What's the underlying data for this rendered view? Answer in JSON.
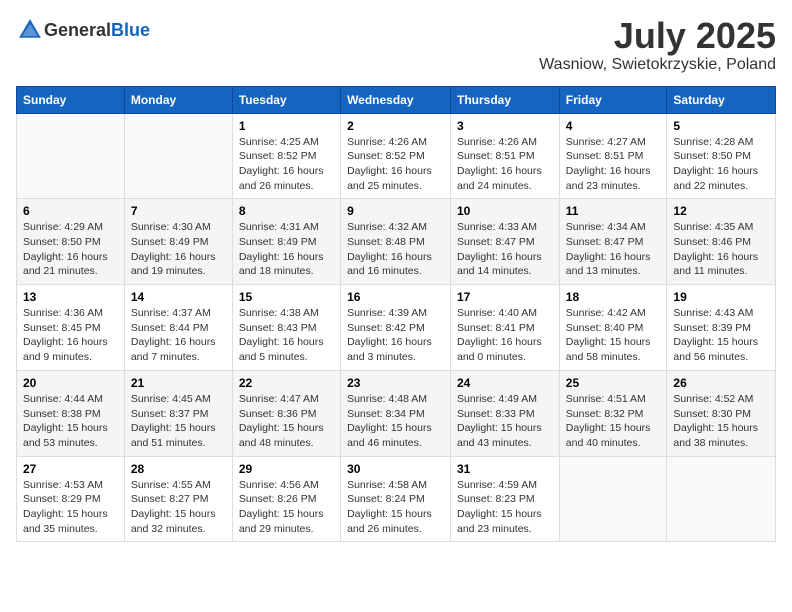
{
  "header": {
    "logo_general": "General",
    "logo_blue": "Blue",
    "month": "July 2025",
    "location": "Wasniow, Swietokrzyskie, Poland"
  },
  "days_of_week": [
    "Sunday",
    "Monday",
    "Tuesday",
    "Wednesday",
    "Thursday",
    "Friday",
    "Saturday"
  ],
  "weeks": [
    [
      {
        "day": "",
        "info": ""
      },
      {
        "day": "",
        "info": ""
      },
      {
        "day": "1",
        "info": "Sunrise: 4:25 AM\nSunset: 8:52 PM\nDaylight: 16 hours and 26 minutes."
      },
      {
        "day": "2",
        "info": "Sunrise: 4:26 AM\nSunset: 8:52 PM\nDaylight: 16 hours and 25 minutes."
      },
      {
        "day": "3",
        "info": "Sunrise: 4:26 AM\nSunset: 8:51 PM\nDaylight: 16 hours and 24 minutes."
      },
      {
        "day": "4",
        "info": "Sunrise: 4:27 AM\nSunset: 8:51 PM\nDaylight: 16 hours and 23 minutes."
      },
      {
        "day": "5",
        "info": "Sunrise: 4:28 AM\nSunset: 8:50 PM\nDaylight: 16 hours and 22 minutes."
      }
    ],
    [
      {
        "day": "6",
        "info": "Sunrise: 4:29 AM\nSunset: 8:50 PM\nDaylight: 16 hours and 21 minutes."
      },
      {
        "day": "7",
        "info": "Sunrise: 4:30 AM\nSunset: 8:49 PM\nDaylight: 16 hours and 19 minutes."
      },
      {
        "day": "8",
        "info": "Sunrise: 4:31 AM\nSunset: 8:49 PM\nDaylight: 16 hours and 18 minutes."
      },
      {
        "day": "9",
        "info": "Sunrise: 4:32 AM\nSunset: 8:48 PM\nDaylight: 16 hours and 16 minutes."
      },
      {
        "day": "10",
        "info": "Sunrise: 4:33 AM\nSunset: 8:47 PM\nDaylight: 16 hours and 14 minutes."
      },
      {
        "day": "11",
        "info": "Sunrise: 4:34 AM\nSunset: 8:47 PM\nDaylight: 16 hours and 13 minutes."
      },
      {
        "day": "12",
        "info": "Sunrise: 4:35 AM\nSunset: 8:46 PM\nDaylight: 16 hours and 11 minutes."
      }
    ],
    [
      {
        "day": "13",
        "info": "Sunrise: 4:36 AM\nSunset: 8:45 PM\nDaylight: 16 hours and 9 minutes."
      },
      {
        "day": "14",
        "info": "Sunrise: 4:37 AM\nSunset: 8:44 PM\nDaylight: 16 hours and 7 minutes."
      },
      {
        "day": "15",
        "info": "Sunrise: 4:38 AM\nSunset: 8:43 PM\nDaylight: 16 hours and 5 minutes."
      },
      {
        "day": "16",
        "info": "Sunrise: 4:39 AM\nSunset: 8:42 PM\nDaylight: 16 hours and 3 minutes."
      },
      {
        "day": "17",
        "info": "Sunrise: 4:40 AM\nSunset: 8:41 PM\nDaylight: 16 hours and 0 minutes."
      },
      {
        "day": "18",
        "info": "Sunrise: 4:42 AM\nSunset: 8:40 PM\nDaylight: 15 hours and 58 minutes."
      },
      {
        "day": "19",
        "info": "Sunrise: 4:43 AM\nSunset: 8:39 PM\nDaylight: 15 hours and 56 minutes."
      }
    ],
    [
      {
        "day": "20",
        "info": "Sunrise: 4:44 AM\nSunset: 8:38 PM\nDaylight: 15 hours and 53 minutes."
      },
      {
        "day": "21",
        "info": "Sunrise: 4:45 AM\nSunset: 8:37 PM\nDaylight: 15 hours and 51 minutes."
      },
      {
        "day": "22",
        "info": "Sunrise: 4:47 AM\nSunset: 8:36 PM\nDaylight: 15 hours and 48 minutes."
      },
      {
        "day": "23",
        "info": "Sunrise: 4:48 AM\nSunset: 8:34 PM\nDaylight: 15 hours and 46 minutes."
      },
      {
        "day": "24",
        "info": "Sunrise: 4:49 AM\nSunset: 8:33 PM\nDaylight: 15 hours and 43 minutes."
      },
      {
        "day": "25",
        "info": "Sunrise: 4:51 AM\nSunset: 8:32 PM\nDaylight: 15 hours and 40 minutes."
      },
      {
        "day": "26",
        "info": "Sunrise: 4:52 AM\nSunset: 8:30 PM\nDaylight: 15 hours and 38 minutes."
      }
    ],
    [
      {
        "day": "27",
        "info": "Sunrise: 4:53 AM\nSunset: 8:29 PM\nDaylight: 15 hours and 35 minutes."
      },
      {
        "day": "28",
        "info": "Sunrise: 4:55 AM\nSunset: 8:27 PM\nDaylight: 15 hours and 32 minutes."
      },
      {
        "day": "29",
        "info": "Sunrise: 4:56 AM\nSunset: 8:26 PM\nDaylight: 15 hours and 29 minutes."
      },
      {
        "day": "30",
        "info": "Sunrise: 4:58 AM\nSunset: 8:24 PM\nDaylight: 15 hours and 26 minutes."
      },
      {
        "day": "31",
        "info": "Sunrise: 4:59 AM\nSunset: 8:23 PM\nDaylight: 15 hours and 23 minutes."
      },
      {
        "day": "",
        "info": ""
      },
      {
        "day": "",
        "info": ""
      }
    ]
  ]
}
